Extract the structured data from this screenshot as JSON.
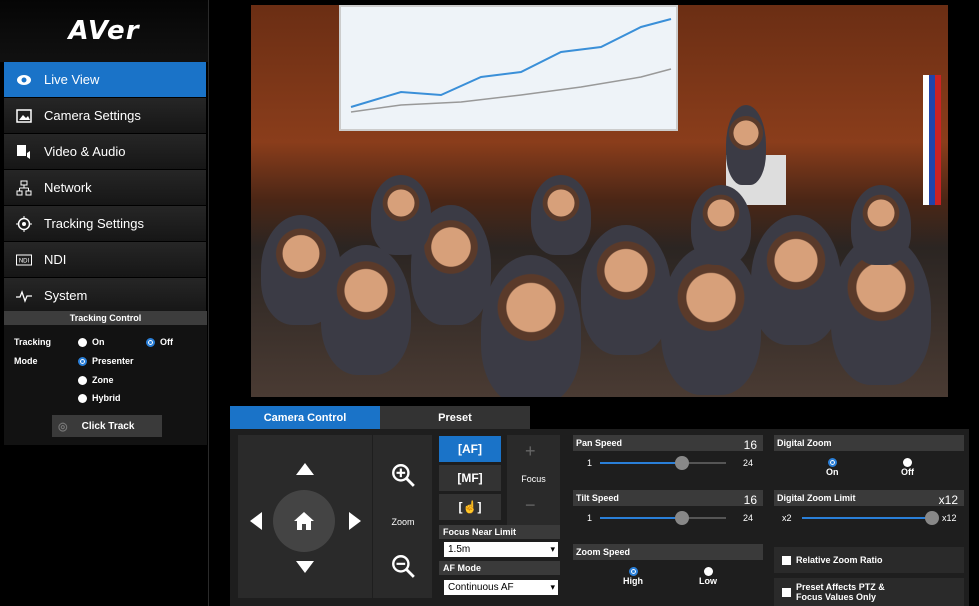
{
  "brand": {
    "logo_text": "AVer"
  },
  "sidebar": {
    "items": [
      {
        "label": "Live View",
        "icon": "eye-icon",
        "active": true
      },
      {
        "label": "Camera Settings",
        "icon": "image-icon",
        "active": false
      },
      {
        "label": "Video & Audio",
        "icon": "video-audio-icon",
        "active": false
      },
      {
        "label": "Network",
        "icon": "network-icon",
        "active": false
      },
      {
        "label": "Tracking Settings",
        "icon": "target-icon",
        "active": false
      },
      {
        "label": "NDI",
        "icon": "ndi-icon",
        "active": false
      },
      {
        "label": "System",
        "icon": "pulse-icon",
        "active": false
      }
    ]
  },
  "tracking_control": {
    "title": "Tracking Control",
    "tracking_label": "Tracking",
    "mode_label": "Mode",
    "on_label": "On",
    "off_label": "Off",
    "tracking_selected": "Off",
    "modes": [
      "Presenter",
      "Zone",
      "Hybrid"
    ],
    "mode_selected": "Presenter",
    "click_track_label": "Click Track"
  },
  "tabs": [
    {
      "label": "Camera Control",
      "active": true
    },
    {
      "label": "Preset",
      "active": false
    }
  ],
  "camera_control": {
    "zoom_label": "Zoom",
    "focus_label": "Focus",
    "af_label": "[AF]",
    "mf_label": "[MF]",
    "touch_label": "[☝]",
    "focus_near_limit_label": "Focus Near Limit",
    "focus_near_limit_value": "1.5m",
    "af_mode_label": "AF Mode",
    "af_mode_value": "Continuous AF"
  },
  "pan_speed": {
    "label": "Pan Speed",
    "value": "16",
    "min": "1",
    "max": "24",
    "level": 0.65
  },
  "tilt_speed": {
    "label": "Tilt Speed",
    "value": "16",
    "min": "1",
    "max": "24",
    "level": 0.65
  },
  "zoom_speed": {
    "label": "Zoom Speed",
    "high_label": "High",
    "low_label": "Low",
    "selected": "High"
  },
  "digital_zoom": {
    "label": "Digital Zoom",
    "on_label": "On",
    "off_label": "Off",
    "selected": "On"
  },
  "digital_zoom_limit": {
    "label": "Digital Zoom Limit",
    "value": "x12",
    "min": "x2",
    "max": "x12",
    "level": 1.0
  },
  "relative_zoom_ratio": {
    "label": "Relative Zoom Ratio",
    "checked": false
  },
  "preset_affects": {
    "label": "Preset Affects PTZ & Focus Values Only",
    "checked": false
  },
  "colors": {
    "accent": "#1a73c8",
    "radio_blue": "#2a7fd8"
  }
}
